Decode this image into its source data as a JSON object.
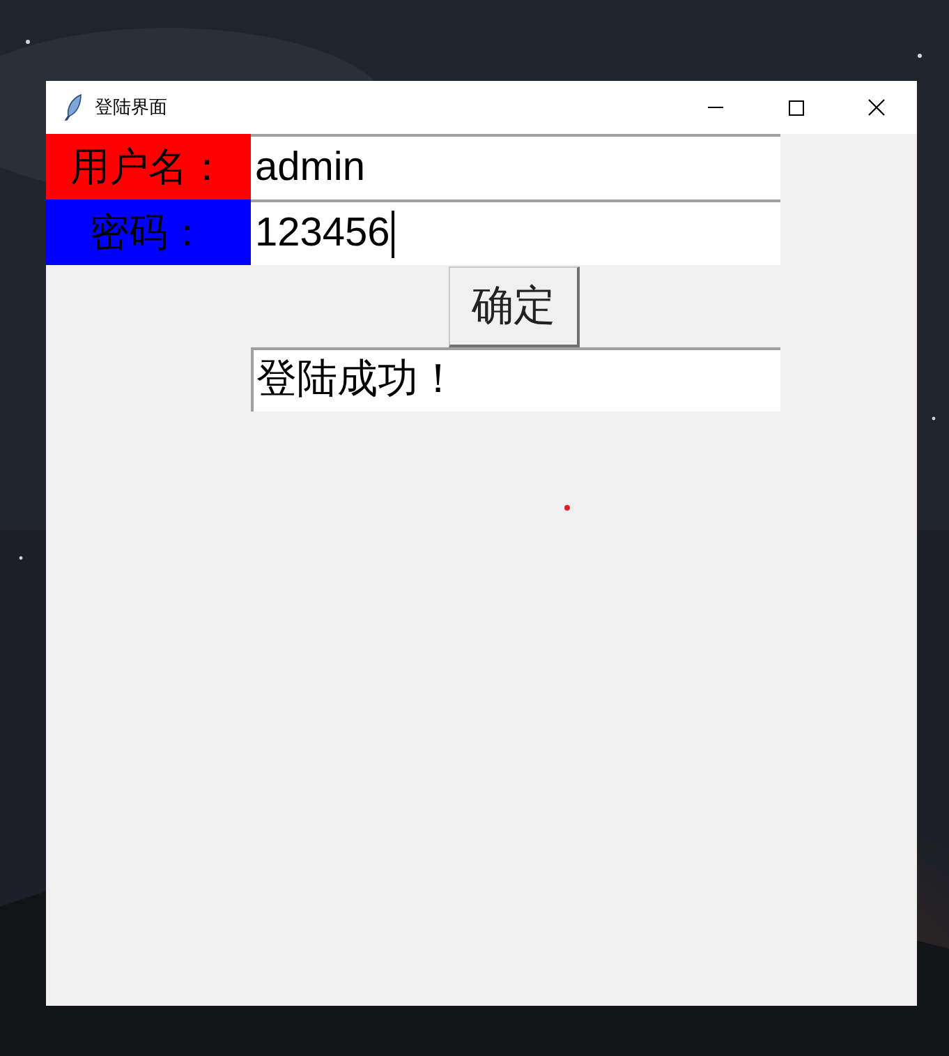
{
  "window": {
    "title": "登陆界面"
  },
  "fields": [
    {
      "label": "用户名：",
      "color": "#ff0000",
      "value": "admin",
      "focused": false
    },
    {
      "label": "密码：",
      "color": "#0000ff",
      "value": "123456",
      "focused": true
    }
  ],
  "button": {
    "label": "确定"
  },
  "result": {
    "value": "登陆成功！"
  }
}
